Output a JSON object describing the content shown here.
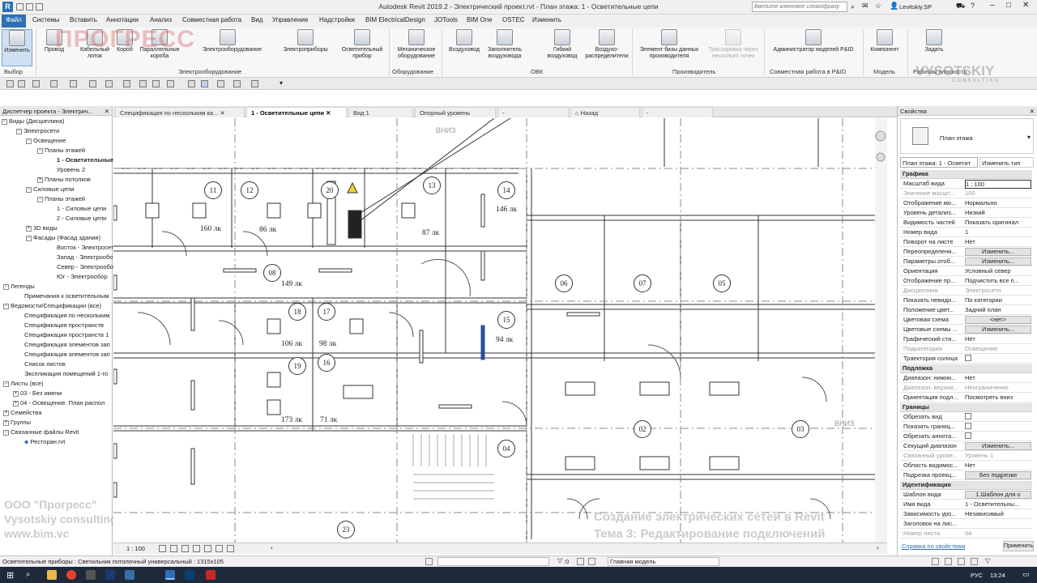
{
  "title": "Autodesk Revit 2019.2 - Электрический проект.rvt - План этажа: 1 - Осветительные цепи",
  "search_placeholder": "Введите ключевое слово/фразу",
  "user": "Levitskiy.SP",
  "menu": [
    "Файл",
    "Системы",
    "Вставить",
    "Аннотации",
    "Анализ",
    "Совместная работа",
    "Вид",
    "Управление",
    "Надстройки",
    "BIM ElectricalDesign",
    "JOTools",
    "BIM One",
    "OSTEC",
    "Изменить"
  ],
  "ribbon": {
    "buttons": [
      "Изменить",
      "Провод",
      "Кабельный лоток",
      "Короб",
      "Параллельные короба",
      "Электрооборудование",
      "Электроприборы",
      "Осветительный прибор",
      "Механическое оборудование",
      "Воздуховод",
      "Заполнитель воздуховода",
      "Гибкий воздуховод",
      "Воздухо-распределители",
      "Элемент базы данных производителя",
      "Трассировка через несколько точек",
      "Администратор моделей P&ID",
      "Компонент",
      "Задать"
    ],
    "groups": [
      "Выбор",
      "Электрооборудование",
      "Оборудование",
      "ОВК",
      "Производитель",
      "Совместная работа в P&ID",
      "Модель",
      "Рабочая плоскость"
    ]
  },
  "browser": {
    "title": "Диспетчер проекта - Электрич...",
    "nodes": [
      "Виды (Дисциплина)",
      "Электросети",
      "Освещение",
      "Планы этажей",
      "1 - Осветительные",
      "Уровень 2",
      "Планы потолков",
      "Силовые цепи",
      "Планы этажей",
      "1 - Силовые цепи",
      "2 - Силовые цепи",
      "3D виды",
      "Фасады (Фасад здания)",
      "Восток - Электросети",
      "Запад - Электрообор",
      "Север - Электрообор",
      "Юг - Электрообор",
      "Легенды",
      "Примечания к осветительным",
      "Ведомости/Спецификации (все)",
      "Спецификация по нескольким",
      "Спецификация пространств",
      "Спецификация пространств 1",
      "Спецификация элементов зап",
      "Спецификация элементов зап",
      "Список листов",
      "Экспликация помещений 1-го",
      "Листы (все)",
      "03 - Без имени",
      "04 - Освещение. План распол",
      "Семейства",
      "Группы",
      "Связанные файлы Revit",
      "Ресторан.rvt"
    ]
  },
  "tabs": [
    "Спецификация по нескольким ка...",
    "1 - Осветительные цепи",
    "Вид 1",
    "Опорный уровень",
    "-",
    "Назад",
    "-"
  ],
  "canvas": {
    "rooms": [
      "11",
      "12",
      "20",
      "13",
      "14",
      "08",
      "18",
      "17",
      "15",
      "19",
      "16",
      "04",
      "23",
      "06",
      "07",
      "05",
      "02",
      "03"
    ],
    "lux": [
      "160 лк",
      "86 лк",
      "87 лк",
      "146 лк",
      "149 лк",
      "106 лк",
      "98 лк",
      "94 лк",
      "173 лк",
      "71 лк"
    ],
    "down_labels": [
      "ВНИЗ",
      "ВНИЗ"
    ],
    "scale": "1 : 100"
  },
  "watermarks": {
    "company1": "ООО \"Прогресс\"",
    "company2": "Vysotskiy consulting",
    "site": "www.bim.vc",
    "course1": "Создание электрических сетей в Revit",
    "course2": "Тема 3: Редактирование подключений",
    "logo_left": "ПРОГРЕСС",
    "logo_right": "VYSOTSKIY",
    "logo_right_sub": "CONSULTING"
  },
  "properties": {
    "title": "Свойства",
    "type_name": "План этажа",
    "selector": "План этажа: 1 - Осветит",
    "edit_type": "Изменить тип",
    "sections": [
      "Графика",
      "Подложка",
      "Границы",
      "Идентификация"
    ],
    "graphics": [
      [
        "Масштаб вида",
        "1 : 100"
      ],
      [
        "Значение масшт...",
        "100"
      ],
      [
        "Отображение мо...",
        "Нормально"
      ],
      [
        "Уровень детализ...",
        "Низкий"
      ],
      [
        "Видимость частей",
        "Показать оригинал"
      ],
      [
        "Номер вида",
        "1"
      ],
      [
        "Поворот на листе",
        "Нет"
      ],
      [
        "Переопределени...",
        "Изменить..."
      ],
      [
        "Параметры отоб...",
        "Изменить..."
      ],
      [
        "Ориентация",
        "Условный север"
      ],
      [
        "Отображение пр...",
        "Подчистить все п..."
      ],
      [
        "Дисциплина",
        "Электросети"
      ],
      [
        "Показать невиди...",
        "По категории"
      ],
      [
        "Положение цвет...",
        "Задний план"
      ],
      [
        "Цветовая схема",
        "<нет>"
      ],
      [
        "Цветовые схемы ...",
        "Изменить..."
      ],
      [
        "Графический сти...",
        "Нет"
      ],
      [
        "Подкатегория",
        "Освещение"
      ],
      [
        "Траектория солнца",
        ""
      ]
    ],
    "underlay": [
      [
        "Диапазон: нижни...",
        "Нет"
      ],
      [
        "Диапазон: верхни...",
        "Неограниченно"
      ],
      [
        "Ориентация подл...",
        "Посмотреть вниз"
      ]
    ],
    "extents": [
      [
        "Обрезать вид",
        ""
      ],
      [
        "Показать границ...",
        ""
      ],
      [
        "Обрезать аннота...",
        ""
      ],
      [
        "Секущий диапазон",
        "Изменить..."
      ],
      [
        "Связанный урове...",
        "Уровень 1"
      ],
      [
        "Область видимос...",
        "Нет"
      ],
      [
        "Подрезка проекц...",
        "Без подрезки"
      ]
    ],
    "identity": [
      [
        "Шаблон вида",
        "1.Шаблон для о"
      ],
      [
        "Имя вида",
        "1 - Осветительны..."
      ],
      [
        "Зависимость уро...",
        "Независимый"
      ],
      [
        "Заголовок на лис...",
        ""
      ],
      [
        "Номер листа",
        "04"
      ]
    ],
    "help": "Справка по свойствам",
    "apply": "Применить"
  },
  "status": {
    "text": "Осветительные приборы : Светильник потолочный универсальный : 1315x105",
    "filter": ":0",
    "model": "Главная модель",
    "time": "13:24",
    "lang": "РУС"
  },
  "colors": {
    "accent": "#2e6fb7",
    "selected": "#2b4fa0"
  }
}
